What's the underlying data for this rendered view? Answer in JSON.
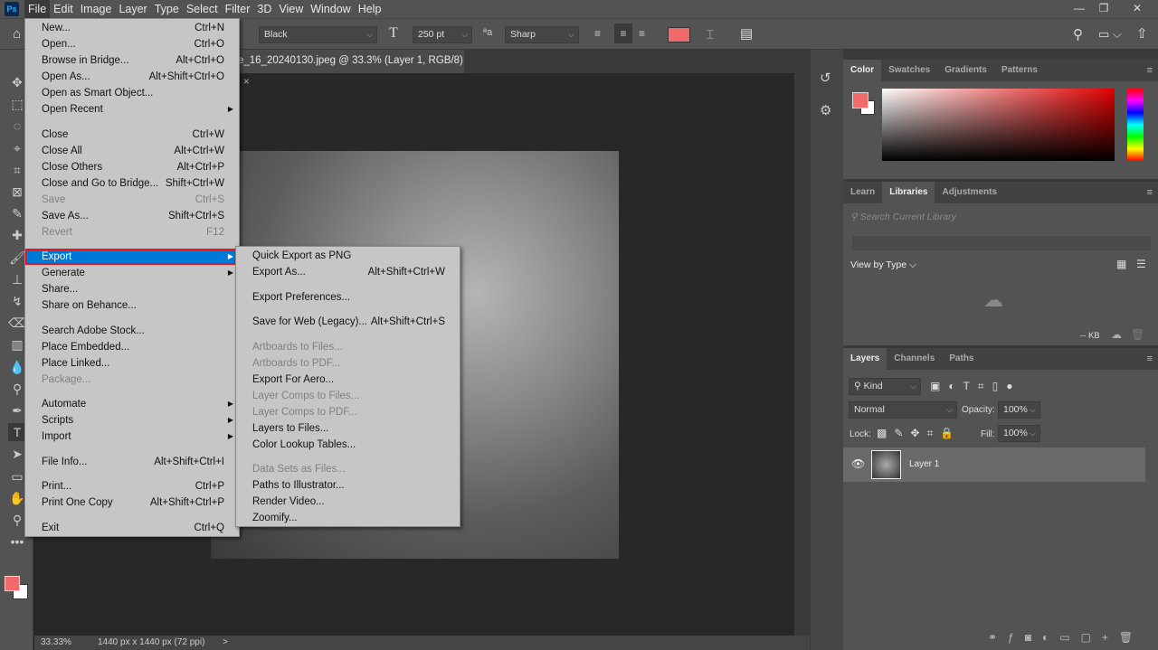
{
  "app": {
    "logo": "Ps"
  },
  "menubar": [
    "File",
    "Edit",
    "Image",
    "Layer",
    "Type",
    "Select",
    "Filter",
    "3D",
    "View",
    "Window",
    "Help"
  ],
  "options": {
    "font_style": "Black",
    "font_size": "250 pt",
    "aa_label": "aa",
    "antialias": "Sharp",
    "text_color": "#f06a6a"
  },
  "document": {
    "tab_title": "e_16_20240130.jpeg @ 33.3% (Layer 1, RGB/8)",
    "close": "×"
  },
  "status": {
    "zoom": "33.33%",
    "info": "1440 px x 1440 px (72 ppi)",
    "arrow": ">"
  },
  "file_menu": [
    {
      "label": "New...",
      "shortcut": "Ctrl+N"
    },
    {
      "label": "Open...",
      "shortcut": "Ctrl+O"
    },
    {
      "label": "Browse in Bridge...",
      "shortcut": "Alt+Ctrl+O"
    },
    {
      "label": "Open As...",
      "shortcut": "Alt+Shift+Ctrl+O"
    },
    {
      "label": "Open as Smart Object..."
    },
    {
      "label": "Open Recent",
      "submenu": true
    },
    {
      "sep": true
    },
    {
      "label": "Close",
      "shortcut": "Ctrl+W"
    },
    {
      "label": "Close All",
      "shortcut": "Alt+Ctrl+W"
    },
    {
      "label": "Close Others",
      "shortcut": "Alt+Ctrl+P"
    },
    {
      "label": "Close and Go to Bridge...",
      "shortcut": "Shift+Ctrl+W"
    },
    {
      "label": "Save",
      "shortcut": "Ctrl+S",
      "disabled": true
    },
    {
      "label": "Save As...",
      "shortcut": "Shift+Ctrl+S"
    },
    {
      "label": "Revert",
      "shortcut": "F12",
      "disabled": true
    },
    {
      "sep": true
    },
    {
      "label": "Export",
      "submenu": true,
      "highlighted": true
    },
    {
      "label": "Generate",
      "submenu": true
    },
    {
      "label": "Share..."
    },
    {
      "label": "Share on Behance..."
    },
    {
      "sep": true
    },
    {
      "label": "Search Adobe Stock..."
    },
    {
      "label": "Place Embedded..."
    },
    {
      "label": "Place Linked..."
    },
    {
      "label": "Package...",
      "disabled": true
    },
    {
      "sep": true
    },
    {
      "label": "Automate",
      "submenu": true
    },
    {
      "label": "Scripts",
      "submenu": true
    },
    {
      "label": "Import",
      "submenu": true
    },
    {
      "sep": true
    },
    {
      "label": "File Info...",
      "shortcut": "Alt+Shift+Ctrl+I"
    },
    {
      "sep": true
    },
    {
      "label": "Print...",
      "shortcut": "Ctrl+P"
    },
    {
      "label": "Print One Copy",
      "shortcut": "Alt+Shift+Ctrl+P"
    },
    {
      "sep": true
    },
    {
      "label": "Exit",
      "shortcut": "Ctrl+Q"
    }
  ],
  "export_menu": [
    {
      "label": "Quick Export as PNG"
    },
    {
      "label": "Export As...",
      "shortcut": "Alt+Shift+Ctrl+W"
    },
    {
      "sep": true
    },
    {
      "label": "Export Preferences..."
    },
    {
      "sep": true
    },
    {
      "label": "Save for Web (Legacy)...",
      "shortcut": "Alt+Shift+Ctrl+S"
    },
    {
      "sep": true
    },
    {
      "label": "Artboards to Files...",
      "disabled": true
    },
    {
      "label": "Artboards to PDF...",
      "disabled": true
    },
    {
      "label": "Export For Aero..."
    },
    {
      "label": "Layer Comps to Files...",
      "disabled": true
    },
    {
      "label": "Layer Comps to PDF...",
      "disabled": true
    },
    {
      "label": "Layers to Files..."
    },
    {
      "label": "Color Lookup Tables..."
    },
    {
      "sep": true
    },
    {
      "label": "Data Sets as Files...",
      "disabled": true
    },
    {
      "label": "Paths to Illustrator..."
    },
    {
      "label": "Render Video..."
    },
    {
      "label": "Zoomify..."
    }
  ],
  "color_panel": {
    "tabs": [
      "Color",
      "Swatches",
      "Gradients",
      "Patterns"
    ],
    "fg": "#f06a6a",
    "bg": "#ffffff"
  },
  "libraries_panel": {
    "tabs": [
      "Learn",
      "Libraries",
      "Adjustments"
    ],
    "search_placeholder": "Search Current Library",
    "view_by": "View by Type",
    "size": "-- KB"
  },
  "layers_panel": {
    "tabs": [
      "Layers",
      "Channels",
      "Paths"
    ],
    "filter": "Kind",
    "blend": "Normal",
    "opacity_label": "Opacity:",
    "opacity": "100%",
    "lock_label": "Lock:",
    "fill_label": "Fill:",
    "fill": "100%",
    "layers": [
      {
        "name": "Layer 1",
        "visible": true
      }
    ]
  }
}
